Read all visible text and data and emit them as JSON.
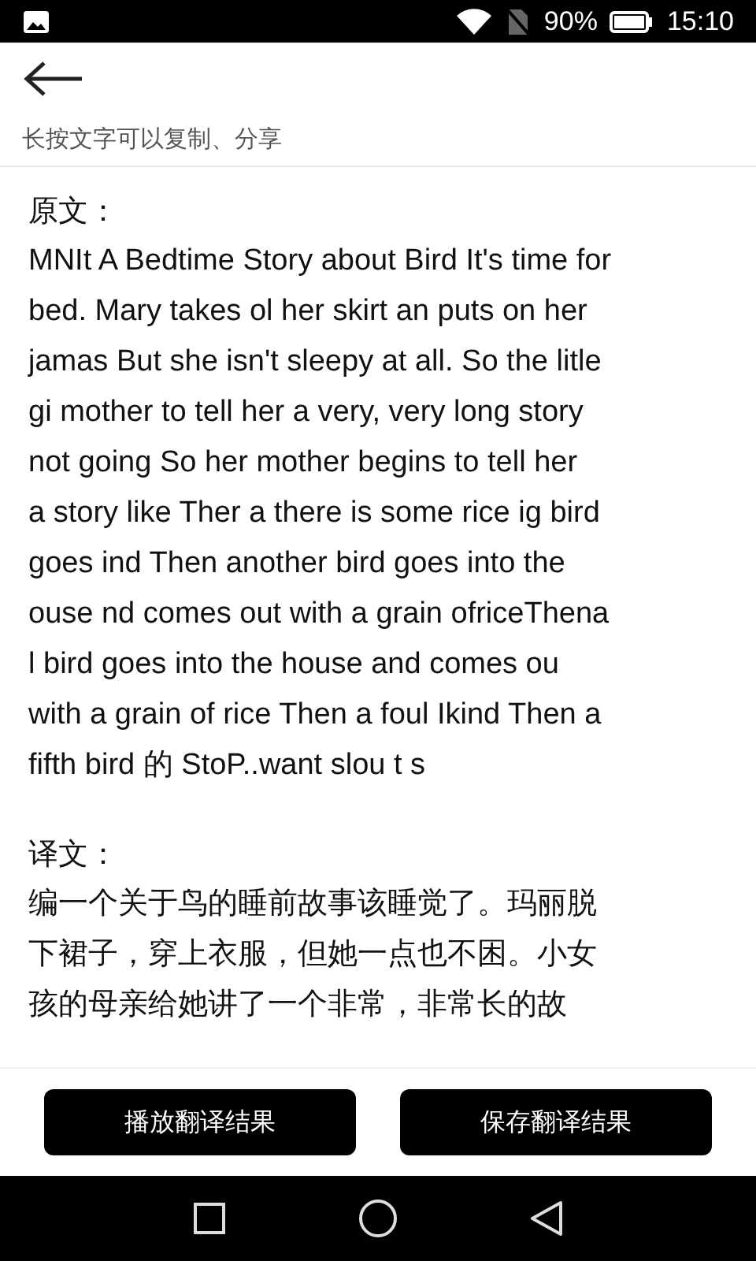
{
  "status_bar": {
    "battery": "90%",
    "time": "15:10"
  },
  "header": {
    "hint": "长按文字可以复制、分享"
  },
  "original": {
    "label": "原文：",
    "lines": [
      "MNIt A Bedtime Story about Bird It's time for",
      "bed. Mary takes ol her skirt an puts on her",
      "jamas But she isn't sleepy at all. So the litle",
      "gi mother to tell her a very, very long story",
      "not going So her mother begins to tell her",
      "a story like Ther a there is some rice ig bird",
      "goes ind Then another bird goes into the",
      "ouse nd comes out with a grain ofriceThena",
      "l bird goes into the house and comes ou",
      "with a grain of rice Then a foul Ikind Then a",
      "fifth bird 的 StoP..want slou t s"
    ]
  },
  "translation": {
    "label": "译文：",
    "lines": [
      "编一个关于鸟的睡前故事该睡觉了。玛丽脱",
      "下裙子，穿上衣服，但她一点也不困。小女",
      "孩的母亲给她讲了一个非常，非常长的故"
    ]
  },
  "buttons": [
    "播放翻译结果",
    "保存翻译结果"
  ]
}
